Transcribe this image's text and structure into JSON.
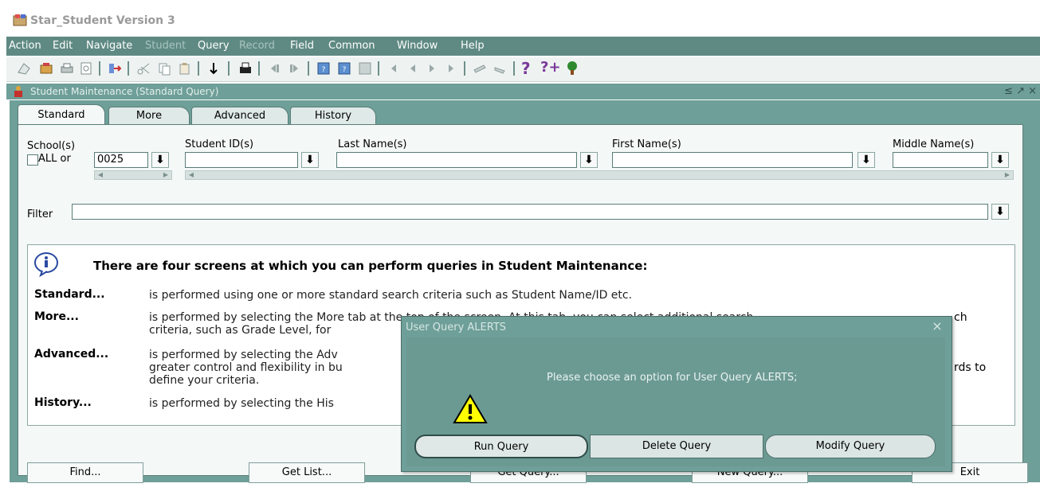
{
  "window": {
    "title": "Star_Student Version 3"
  },
  "menu": [
    {
      "label": "Action",
      "disabled": false
    },
    {
      "label": "Edit",
      "disabled": false
    },
    {
      "label": "Navigate",
      "disabled": false
    },
    {
      "label": "Student",
      "disabled": true
    },
    {
      "label": "Query",
      "disabled": false
    },
    {
      "label": "Record",
      "disabled": true
    },
    {
      "label": "Field",
      "disabled": false
    },
    {
      "label": "Common",
      "disabled": false
    },
    {
      "label": "Window",
      "disabled": false
    },
    {
      "label": "Help",
      "disabled": false
    }
  ],
  "toolbar": {
    "help_glyph": "?",
    "help2_glyph": "?+"
  },
  "form": {
    "title": "Student Maintenance (Standard Query)",
    "window_controls": "≤ ↗ ×",
    "tabs": [
      "Standard",
      "More",
      "Advanced",
      "History"
    ],
    "school_label": "School(s)",
    "all_label": "ALL or",
    "school_value": "0025",
    "student_id_label": "Student ID(s)",
    "last_name_label": "Last Name(s)",
    "first_name_label": "First Name(s)",
    "middle_name_label": "Middle Name(s)",
    "filter_label": "Filter",
    "lov_glyph": "⬇"
  },
  "info": {
    "heading": "There are four screens at which you can perform queries in Student Maintenance:",
    "rows": [
      {
        "term": "Standard...",
        "desc": "is performed using one or more standard search criteria such as Student Name/ID etc."
      },
      {
        "term": "More...",
        "desc": "is performed by selecting the More tab at the top of the screen. At this tab, you can select additional search",
        "desc2": "criteria, such as Grade Level, for"
      },
      {
        "term": "Advanced...",
        "desc": "is performed by selecting the Adv",
        "desc2": "greater control and flexibility in bu",
        "desc3": "define your criteria.",
        "tail": "rds to"
      },
      {
        "term": "History...",
        "desc": "is performed by selecting the His"
      }
    ],
    "tail_ch": "ch"
  },
  "buttons": {
    "find": "Find...",
    "get_list": "Get List...",
    "get_query": "Get Query...",
    "new_query": "New Query...",
    "exit": "Exit"
  },
  "dialog": {
    "title": "User Query ALERTS",
    "close": "×",
    "message": "Please choose an option for User Query ALERTS;",
    "run": "Run Query",
    "delete": "Delete Query",
    "modify": "Modify Query"
  },
  "colors": {
    "accent": "#6e9f98",
    "menubar": "#5f8a83",
    "panel": "#f4f8f7"
  }
}
